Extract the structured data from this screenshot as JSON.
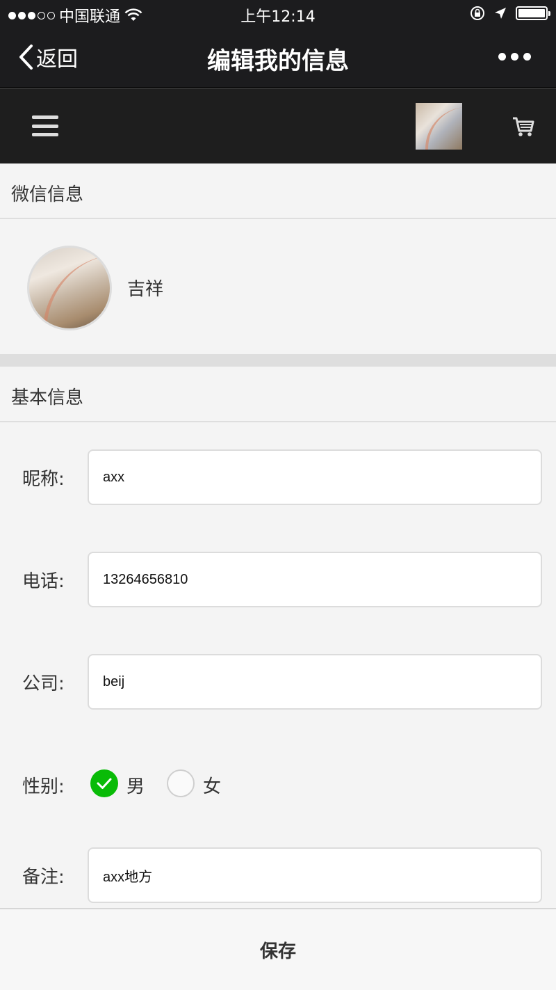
{
  "status_bar": {
    "carrier": "中国联通",
    "time": "上午12:14",
    "signal_bars_on": 3,
    "signal_bars_total": 5,
    "battery_level": 1.0
  },
  "nav": {
    "back_label": "返回",
    "title": "编辑我的信息"
  },
  "sections": {
    "wechat_title": "微信信息",
    "basic_title": "基本信息"
  },
  "wechat": {
    "name": "吉祥"
  },
  "form": {
    "nickname_label": "昵称:",
    "nickname_value": "axx",
    "phone_label": "电话:",
    "phone_value": "13264656810",
    "company_label": "公司:",
    "company_value": "beij",
    "gender_label": "性别:",
    "gender_options": [
      "男",
      "女"
    ],
    "gender_selected": "男",
    "remark_label": "备注:",
    "remark_value": "axx地方"
  },
  "actions": {
    "save_label": "保存"
  },
  "colors": {
    "nav_background": "#1c1c1e",
    "radio_checked": "#09bb07"
  },
  "icons": [
    "wifi-icon",
    "orientation-lock-icon",
    "location-arrow-icon",
    "battery-icon",
    "back-chevron-icon",
    "more-dots-icon",
    "menu-icon",
    "cart-icon",
    "checkmark-icon"
  ]
}
